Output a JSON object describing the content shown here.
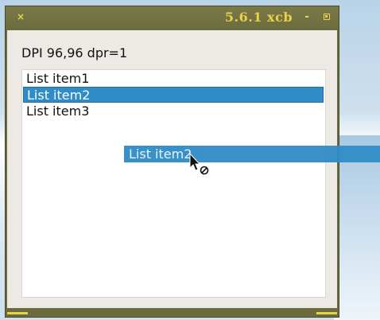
{
  "window": {
    "title": "5.6.1 xcb",
    "close_glyph": "×",
    "minimize_glyph": "-",
    "accent_color": "#e8d24a",
    "frame_color": "#6b6b3e"
  },
  "content": {
    "dpi_label": "DPI 96,96 dpr=1"
  },
  "list": {
    "items": [
      {
        "label": "List item1",
        "selected": false
      },
      {
        "label": "List item2",
        "selected": true
      },
      {
        "label": "List item3",
        "selected": false
      }
    ],
    "selection_color": "#308cc6"
  },
  "drag": {
    "label": "List item2",
    "cursor_icon": "arrow-no-drop-cursor-icon"
  }
}
